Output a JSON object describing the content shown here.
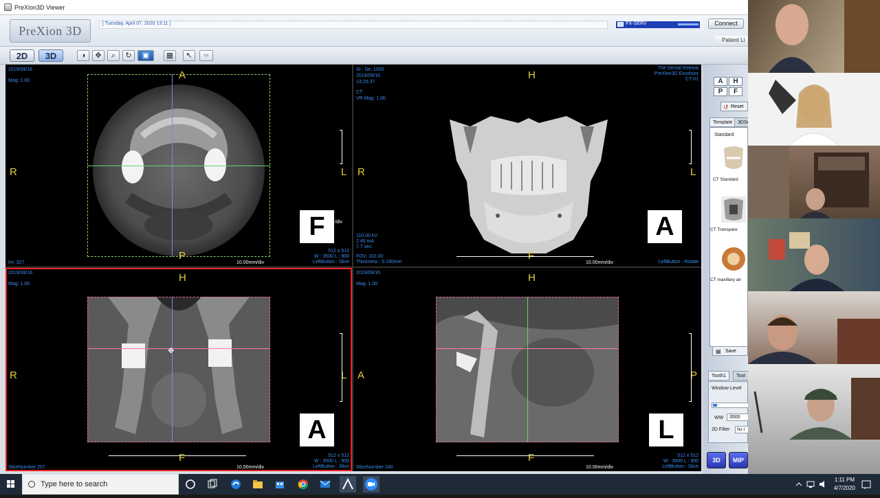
{
  "window": {
    "title": "PreXion3D Viewer",
    "logo": "PreXion 3D",
    "datetime": "[ Tuesday, April 07, 2020  13:11 ]",
    "server": "PX-SERV",
    "connect_label": "Connect",
    "patient_list_label": "Patient Li"
  },
  "toolbar": {
    "mode_2d": "2D",
    "mode_3d": "3D"
  },
  "panes": {
    "axial": {
      "date": "2019/09/16",
      "mag": "Mag: 1.00",
      "im": "Im: 327",
      "orient_top": "A",
      "orient_bottom": "P",
      "orient_left": "R",
      "orient_right": "L",
      "cube": "F",
      "cube_small": "/div",
      "scale": "10.00mm/div",
      "matrix": "512 x 512",
      "window": "W : 3500 L : 900",
      "mode": "LeftButton : Slice"
    },
    "volume": {
      "series": "St : Se: 1000",
      "date": "2019/09/16",
      "time": "13:25:37",
      "modality": "CT",
      "mag": "VR Mag: 1.00",
      "institution": "The Dental Retreat",
      "device": "PreXion3D Excelsior",
      "station": "CT-01",
      "kv": "110.00 kV",
      "ma": "2.40 mA",
      "sec": "7.7 sec",
      "fov": "FOV: 102.00",
      "thickness": "Thickness : 0.160mm",
      "orient_top": "H",
      "orient_bottom": "F",
      "orient_left": "R",
      "orient_right": "L",
      "cube": "A",
      "scale": "10.00mm/div",
      "mode": "LeftButton : Rotate"
    },
    "coronal": {
      "date": "2019/09/16",
      "mag": "Mag: 1.00",
      "slice": "SliceNumber 257",
      "orient_top": "H",
      "orient_bottom": "F",
      "orient_left": "R",
      "orient_right": "L",
      "cube": "A",
      "scale": "10.00mm/div",
      "matrix": "512 x 512",
      "window": "W : 3500 L : 900",
      "mode": "LeftButton : Slice"
    },
    "sagittal": {
      "date": "2019/09/16",
      "mag": "Mag: 1.00",
      "slice": "SliceNumber 240",
      "orient_top": "H",
      "orient_bottom": "F",
      "orient_left": "A",
      "orient_right": "P",
      "cube": "L",
      "scale": "10.00mm/div",
      "matrix": "512 x 512",
      "window": "W : 3500 L : 900",
      "mode": "LeftButton : Slice"
    }
  },
  "sidepanel": {
    "reset": "Reset",
    "tab_template": "Template",
    "tab_3dse": "3DSe",
    "standard": "Standard",
    "thumb1": "CT Standard",
    "thumb2": "CT Transpare",
    "thumb3": "CT maxillary air",
    "save": "Save",
    "tab_tooth1": "Tooth1",
    "tab_tooth": "Toot",
    "window_level": "Window Level",
    "ww_label": "WW",
    "ww_value": "3500",
    "filter_label": "2D Filter",
    "filter_value": "No I",
    "btn_3d": "3D",
    "btn_mip": "MIP"
  },
  "taskbar": {
    "search_placeholder": "Type here to search",
    "time": "1:11 PM",
    "date": "4/7/2020"
  }
}
